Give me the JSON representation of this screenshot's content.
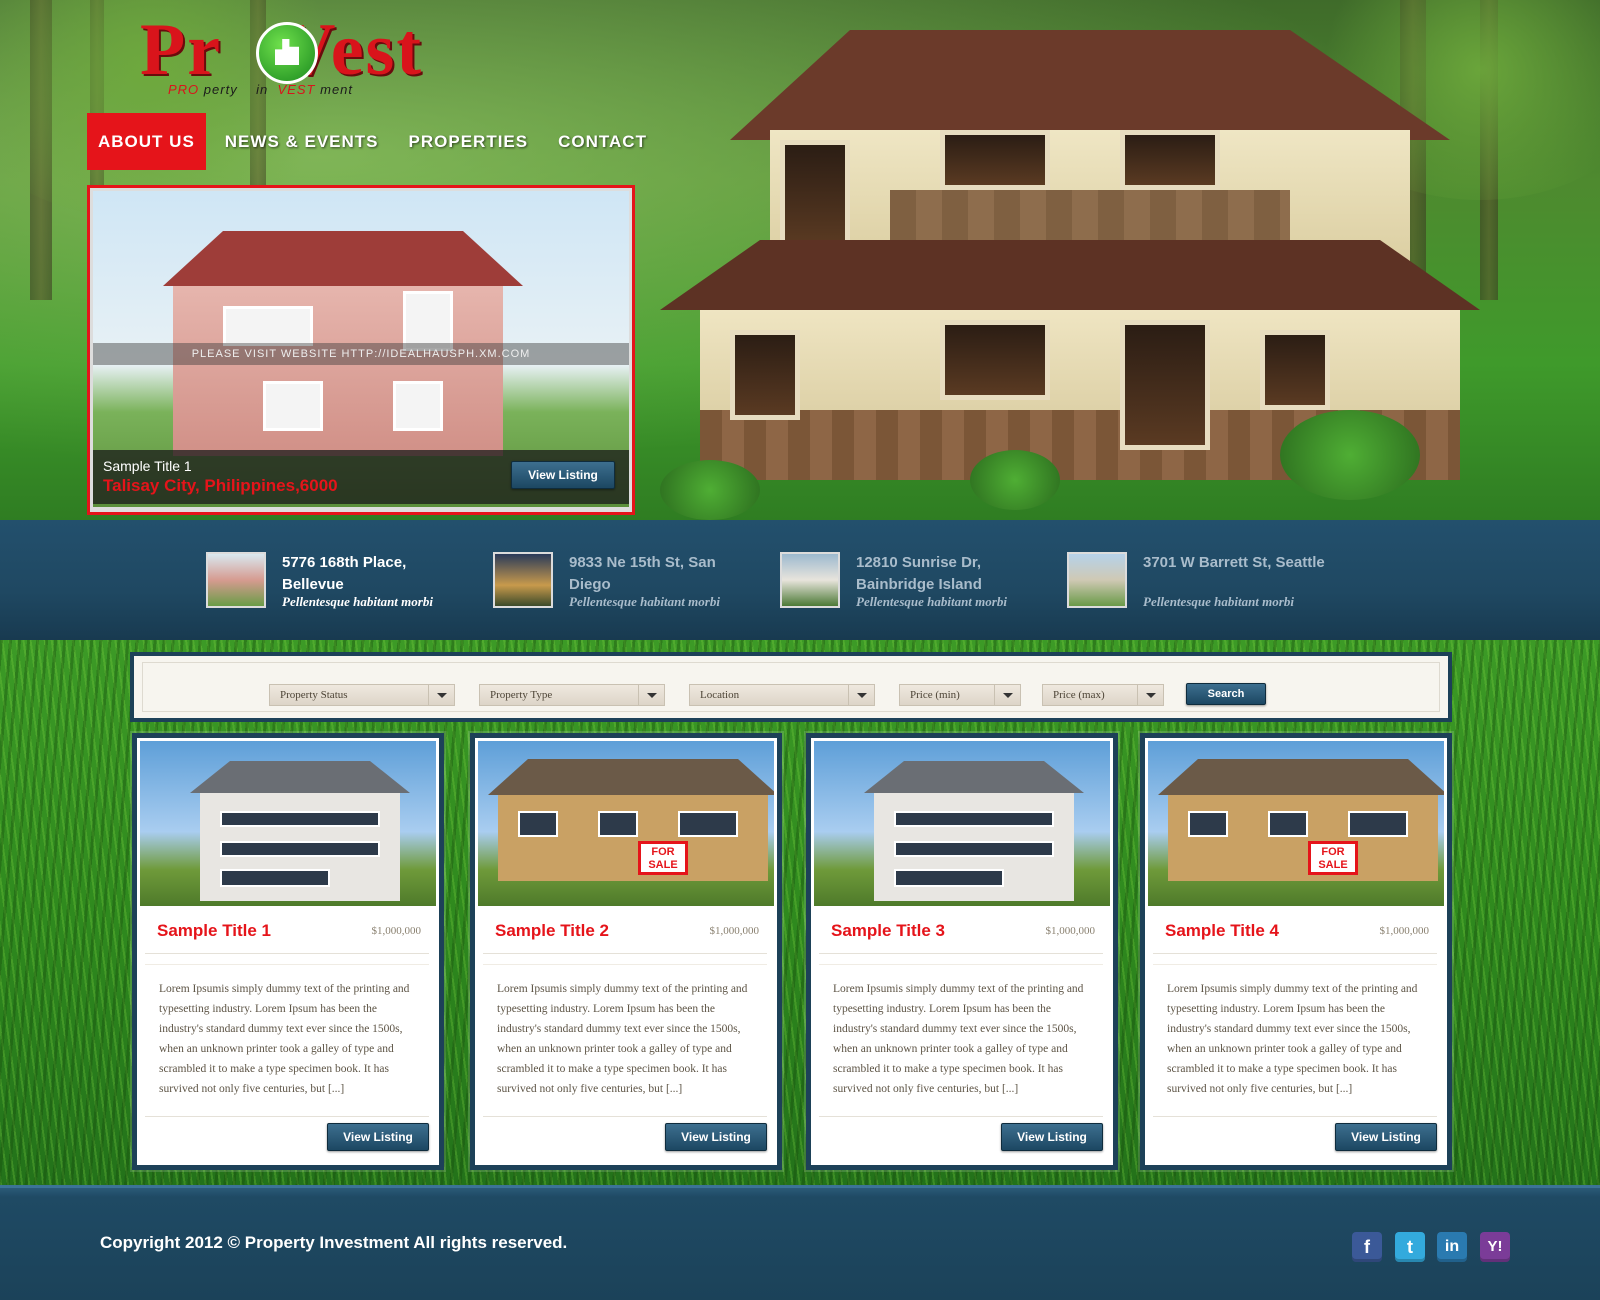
{
  "brand": {
    "logo_text": "ProVest",
    "tagline_parts": [
      "PRO",
      "perty",
      "in",
      "VEST",
      "ment"
    ]
  },
  "nav": {
    "items": [
      {
        "label": "ABOUT US",
        "active": true
      },
      {
        "label": "NEWS & EVENTS",
        "active": false
      },
      {
        "label": "PROPERTIES",
        "active": false
      },
      {
        "label": "CONTACT",
        "active": false
      }
    ]
  },
  "featured": {
    "watermark": "PLEASE VISIT WEBSITE HTTP://IDEALHAUSPH.XM.COM",
    "title": "Sample Title 1",
    "location": "Talisay City, Philippines,6000",
    "button": "View Listing"
  },
  "recent": [
    {
      "title": "5776 168th Place, Bellevue",
      "subtitle": "Pellentesque habitant morbi"
    },
    {
      "title": "9833 Ne 15th St, San Diego",
      "subtitle": "Pellentesque habitant morbi"
    },
    {
      "title": "12810 Sunrise Dr, Bainbridge Island",
      "subtitle": "Pellentesque habitant morbi"
    },
    {
      "title": "3701 W Barrett St, Seattle",
      "subtitle": "Pellentesque habitant morbi"
    }
  ],
  "search": {
    "filters": [
      "Property Status",
      "Property Type",
      "Location",
      "Price (min)",
      "Price (max)"
    ],
    "button": "Search"
  },
  "listings": [
    {
      "title": "Sample Title 1",
      "price": "$1,000,000",
      "description": "Lorem Ipsumis simply dummy text of the printing and typesetting industry. Lorem Ipsum has been the industry's standard dummy text ever since the 1500s, when an unknown printer took a galley of type and scrambled it to make a type specimen book. It has survived not only five centuries, but [...]",
      "button": "View Listing"
    },
    {
      "title": "Sample Title 2",
      "price": "$1,000,000",
      "description": "Lorem Ipsumis simply dummy text of the printing and typesetting industry. Lorem Ipsum has been the industry's standard dummy text ever since the 1500s, when an unknown printer took a galley of type and scrambled it to make a type specimen book. It has survived not only five centuries, but [...]",
      "button": "View Listing"
    },
    {
      "title": "Sample Title 3",
      "price": "$1,000,000",
      "description": "Lorem Ipsumis simply dummy text of the printing and typesetting industry. Lorem Ipsum has been the industry's standard dummy text ever since the 1500s, when an unknown printer took a galley of type and scrambled it to make a type specimen book. It has survived not only five centuries, but [...]",
      "button": "View Listing"
    },
    {
      "title": "Sample Title 4",
      "price": "$1,000,000",
      "description": "Lorem Ipsumis simply dummy text of the printing and typesetting industry. Lorem Ipsum has been the industry's standard dummy text ever since the 1500s, when an unknown printer took a galley of type and scrambled it to make a type specimen book. It has survived not only five centuries, but [...]",
      "button": "View Listing"
    }
  ],
  "sale_sign": [
    "FOR",
    "SALE"
  ],
  "footer": {
    "copyright": "Copyright 2012 © Property Investment  All rights reserved.",
    "social": [
      {
        "icon": "facebook-icon",
        "glyph": "f",
        "color": "#3b5998"
      },
      {
        "icon": "twitter-icon",
        "glyph": "t",
        "color": "#33aadd"
      },
      {
        "icon": "linkedin-icon",
        "glyph": "in",
        "color": "#2a7ab0"
      },
      {
        "icon": "yahoo-icon",
        "glyph": "Y!",
        "color": "#7b3c98"
      }
    ]
  },
  "colors": {
    "accent": "#e5141a",
    "navy": "#1d4158",
    "button": "#2b5a78"
  }
}
